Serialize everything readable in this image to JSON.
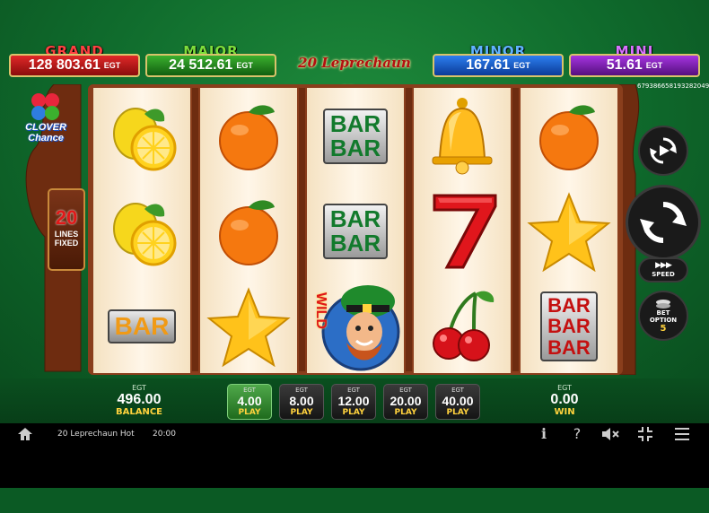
{
  "jackpots": {
    "grand": {
      "name": "GRAND",
      "value": "128 803.61",
      "currency": "EGT"
    },
    "major": {
      "name": "MAJOR",
      "value": "24 512.61",
      "currency": "EGT"
    },
    "minor": {
      "name": "MINOR",
      "value": "167.61",
      "currency": "EGT"
    },
    "mini": {
      "name": "MINI",
      "value": "51.61",
      "currency": "EGT"
    }
  },
  "game_logo": "20 Leprechaun Hot",
  "game_id": "6793866581932820498",
  "side": {
    "clover_logo_line1": "CLOVER",
    "clover_logo_line2": "Chance",
    "lines_number": "20",
    "lines_text1": "LINES",
    "lines_text2": "FIXED"
  },
  "reels": [
    [
      "lemon",
      "lemon",
      "bar"
    ],
    [
      "orange",
      "orange",
      "star"
    ],
    [
      "bar-bar",
      "bar-bar",
      "wild"
    ],
    [
      "bell",
      "seven",
      "cherry"
    ],
    [
      "orange",
      "star",
      "bar-bar-bar"
    ]
  ],
  "symbols": {
    "bar_text": "BAR",
    "wild_text": "WILD"
  },
  "controls": {
    "speed_label": "SPEED",
    "bet_option_label1": "BET",
    "bet_option_label2": "OPTION",
    "bet_option_value": "5"
  },
  "balance": {
    "currency": "EGT",
    "value": "496.00",
    "label": "BALANCE"
  },
  "bets": [
    {
      "currency": "EGT",
      "value": "4.00",
      "label": "PLAY",
      "active": true
    },
    {
      "currency": "EGT",
      "value": "8.00",
      "label": "PLAY",
      "active": false
    },
    {
      "currency": "EGT",
      "value": "12.00",
      "label": "PLAY",
      "active": false
    },
    {
      "currency": "EGT",
      "value": "20.00",
      "label": "PLAY",
      "active": false
    },
    {
      "currency": "EGT",
      "value": "40.00",
      "label": "PLAY",
      "active": false
    }
  ],
  "win": {
    "currency": "EGT",
    "value": "0.00",
    "label": "WIN"
  },
  "toolbar": {
    "title": "20 Leprechaun Hot",
    "clock": "20:00",
    "icons": [
      "home-icon",
      "info-icon",
      "help-icon",
      "mute-icon",
      "fullscreen-icon",
      "menu-icon"
    ]
  },
  "colors": {
    "accent_gold": "#ffd23d",
    "reel_bg": "#fff6e8",
    "frame": "#6e2c10"
  }
}
